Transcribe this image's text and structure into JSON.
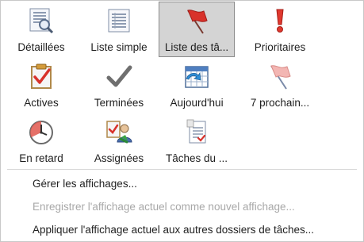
{
  "views": [
    {
      "label": "Détaillées",
      "icon": "detailed-list-magnifier-icon",
      "selected": false
    },
    {
      "label": "Liste simple",
      "icon": "simple-list-icon",
      "selected": false
    },
    {
      "label": "Liste des tâ...",
      "icon": "red-flag-icon",
      "selected": true
    },
    {
      "label": "Prioritaires",
      "icon": "exclamation-icon",
      "selected": false
    },
    {
      "label": "Actives",
      "icon": "active-clipboard-check-icon",
      "selected": false
    },
    {
      "label": "Terminées",
      "icon": "checkmark-icon",
      "selected": false
    },
    {
      "label": "Aujourd'hui",
      "icon": "calendar-arrow-icon",
      "selected": false
    },
    {
      "label": "7 prochain...",
      "icon": "pink-flag-icon",
      "selected": false
    },
    {
      "label": "En retard",
      "icon": "overdue-clock-icon",
      "selected": false
    },
    {
      "label": "Assignées",
      "icon": "assigned-people-icon",
      "selected": false
    },
    {
      "label": "Tâches du ...",
      "icon": "task-document-icon",
      "selected": false
    }
  ],
  "menu": {
    "manage_views": {
      "label": "Gérer les affichages...",
      "accel": "G",
      "enabled": true
    },
    "save_view": {
      "label": "Enregistrer l'affichage actuel comme nouvel affichage...",
      "accel": "E",
      "enabled": false
    },
    "apply_view": {
      "label": "Appliquer l'affichage actuel aux autres dossiers de tâches...",
      "accel": "A",
      "enabled": true
    }
  },
  "colors": {
    "selected_bg": "#d4d4d4",
    "selected_border": "#8a8a8a",
    "accent_red": "#d8322b",
    "disabled_text": "#a8a8a8"
  }
}
